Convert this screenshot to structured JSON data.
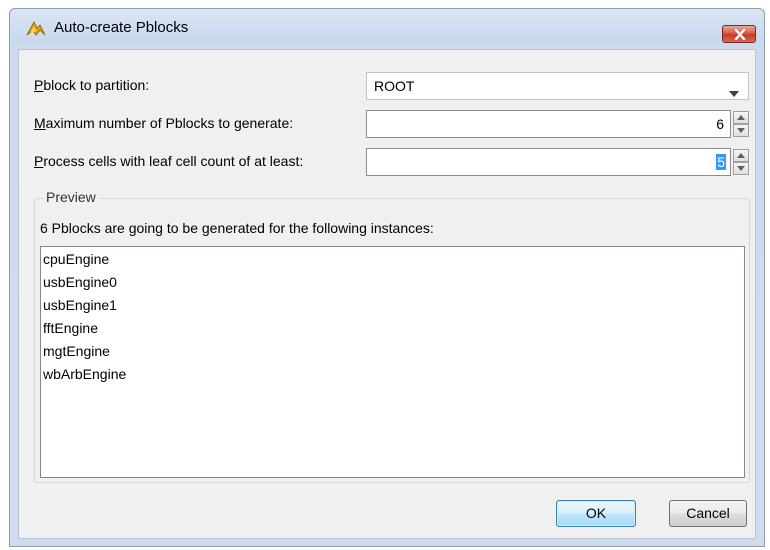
{
  "window": {
    "title": "Auto-create Pblocks",
    "icon": "vivado-logo-icon",
    "close_icon": "close-icon",
    "close_color": "#c9432c"
  },
  "form": {
    "partition": {
      "label_mnemonic": "P",
      "label_rest": "block to partition:",
      "value": "ROOT"
    },
    "max_pblocks": {
      "label_mnemonic": "M",
      "label_rest": "aximum number of Pblocks to generate:",
      "value": "6"
    },
    "min_leaf_cells": {
      "label_mnemonic": "P",
      "label_rest": "rocess cells with leaf cell count of at least:",
      "value": "5"
    }
  },
  "preview": {
    "legend": "Preview",
    "info": "6 Pblocks are going to be generated for the following instances:",
    "instances": [
      "cpuEngine",
      "usbEngine0",
      "usbEngine1",
      "fftEngine",
      "mgtEngine",
      "wbArbEngine"
    ]
  },
  "buttons": {
    "ok": "OK",
    "cancel": "Cancel"
  },
  "colors": {
    "selection": "#3399ff",
    "ok_border": "#3c7fb1"
  }
}
